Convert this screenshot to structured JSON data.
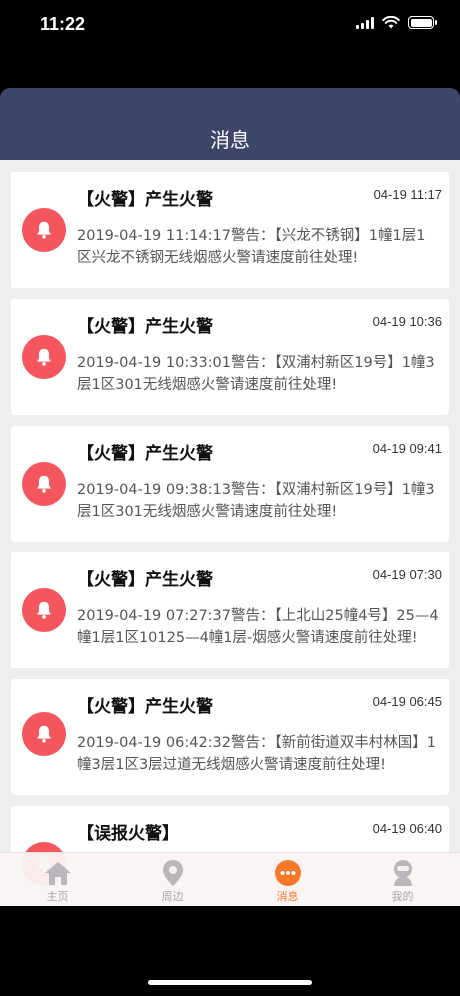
{
  "status_bar": {
    "time": "11:22"
  },
  "header": {
    "title": "消息"
  },
  "messages": [
    {
      "title": "【火警】产生火警",
      "time": "04-19 11:17",
      "body": "2019-04-19 11:14:17警告：【兴龙不锈钢】1幢1层1区兴龙不锈钢无线烟感火警请速度前往处理!"
    },
    {
      "title": "【火警】产生火警",
      "time": "04-19 10:36",
      "body": "2019-04-19 10:33:01警告：【双浦村新区19号】1幢3层1区301无线烟感火警请速度前往处理!"
    },
    {
      "title": "【火警】产生火警",
      "time": "04-19 09:41",
      "body": "2019-04-19 09:38:13警告：【双浦村新区19号】1幢3层1区301无线烟感火警请速度前往处理!"
    },
    {
      "title": "【火警】产生火警",
      "time": "04-19 07:30",
      "body": "2019-04-19 07:27:37警告：【上北山25幢4号】25—4幢1层1区10125—4幢1层-烟感火警请速度前往处理!"
    },
    {
      "title": "【火警】产生火警",
      "time": "04-19 06:45",
      "body": "2019-04-19 06:42:32警告：【新前街道双丰村林国】1幢3层1区3层过道无线烟感火警请速度前往处理!"
    },
    {
      "title": "【误报火警】",
      "time": "04-19 06:40",
      "body": ""
    }
  ],
  "tabbar": {
    "items": [
      {
        "label": "主页",
        "icon": "home-icon"
      },
      {
        "label": "周边",
        "icon": "location-pin-icon"
      },
      {
        "label": "消息",
        "icon": "message-icon"
      },
      {
        "label": "我的",
        "icon": "profile-icon"
      }
    ],
    "active": "消息"
  },
  "colors": {
    "header": "#3d4568",
    "bell": "#f5555c",
    "active_tab": "#f47a2a",
    "inactive_tab": "#a6a6ac"
  }
}
